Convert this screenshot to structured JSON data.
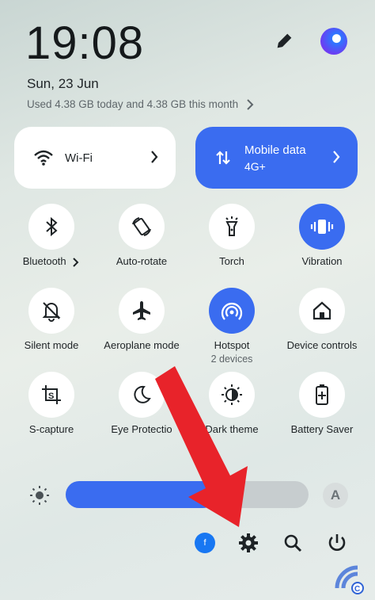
{
  "status": {
    "time": "19:08",
    "date": "Sun, 23 Jun",
    "usage": "Used 4.38 GB today and 4.38 GB this month"
  },
  "tiles": {
    "wifi": {
      "label": "Wi-Fi"
    },
    "mobile": {
      "label": "Mobile data",
      "sub": "4G+"
    }
  },
  "toggles": [
    {
      "label": "Bluetooth",
      "icon": "bluetooth-icon",
      "active": false
    },
    {
      "label": "Auto-rotate",
      "icon": "auto-rotate-icon",
      "active": false
    },
    {
      "label": "Torch",
      "icon": "torch-icon",
      "active": false
    },
    {
      "label": "Vibration",
      "icon": "vibration-icon",
      "active": true
    },
    {
      "label": "Silent mode",
      "icon": "silent-bell-icon",
      "active": false
    },
    {
      "label": "Aeroplane mode",
      "icon": "airplane-icon",
      "active": false
    },
    {
      "label": "Hotspot",
      "sub": "2 devices",
      "icon": "hotspot-icon",
      "active": true
    },
    {
      "label": "Device controls",
      "icon": "home-icon",
      "active": false
    },
    {
      "label": "S-capture",
      "icon": "screenshot-icon",
      "active": false
    },
    {
      "label": "Eye Protectio",
      "icon": "moon-icon",
      "active": false
    },
    {
      "label": "Dark theme",
      "icon": "contrast-icon",
      "active": false
    },
    {
      "label": "Battery Saver",
      "icon": "battery-icon",
      "active": false
    }
  ],
  "brightness": {
    "level": 0.62,
    "auto_label": "A"
  },
  "bottom": {
    "fb_label": "f"
  },
  "colors": {
    "accent": "#3a6cf0",
    "arrow": "#e8232a"
  }
}
